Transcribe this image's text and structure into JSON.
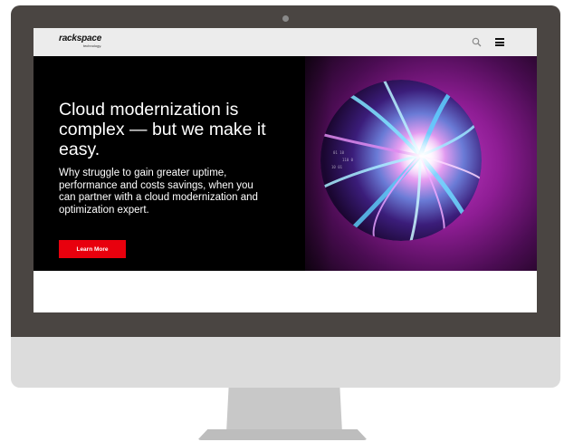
{
  "header": {
    "logo_main": "rackspace",
    "logo_sub": "technology.",
    "search_icon": "search-icon",
    "menu_icon": "hamburger-menu-icon"
  },
  "hero": {
    "title": "Cloud modernization is complex — but we make it easy.",
    "body": "Why struggle to gain greater uptime, performance and costs savings, when you can partner with a cloud modernization and optimization expert.",
    "cta_label": "Learn More",
    "image": "light-speed-tunnel-orb"
  },
  "colors": {
    "accent": "#e8000d",
    "hero_bg": "#000000",
    "glow": "#c23bc7",
    "bezel": "#4a4542",
    "header_bg": "#ececec"
  }
}
